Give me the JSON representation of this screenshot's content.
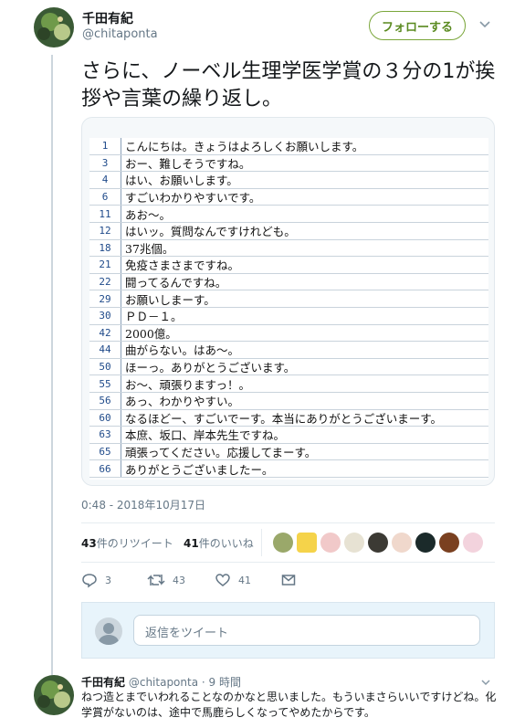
{
  "tweet": {
    "author_name": "千田有紀",
    "author_handle": "@chitaponta",
    "follow_label": "フォローする",
    "text": "さらに、ノーベル生理学医学賞の３分の1が挨拶や言葉の繰り返し。",
    "timestamp": "0:48 - 2018年10月17日"
  },
  "transcript_rows": [
    {
      "num": "1",
      "text": "こんにちは。きょうはよろしくお願いします。"
    },
    {
      "num": "3",
      "text": "おー、難しそうですね。"
    },
    {
      "num": "4",
      "text": "はい、お願いします。"
    },
    {
      "num": "6",
      "text": "すごいわかりやすいです。"
    },
    {
      "num": "11",
      "text": "あお～。"
    },
    {
      "num": "12",
      "text": "はいッ。質問なんですけれども。"
    },
    {
      "num": "18",
      "text": "37兆個。"
    },
    {
      "num": "21",
      "text": "免疫さまさまですね。"
    },
    {
      "num": "22",
      "text": "闘ってるんですね。"
    },
    {
      "num": "29",
      "text": "お願いしまーす。"
    },
    {
      "num": "30",
      "text": "ＰＤ－１。"
    },
    {
      "num": "42",
      "text": "2000億。"
    },
    {
      "num": "44",
      "text": "曲がらない。はあ～。"
    },
    {
      "num": "50",
      "text": "ほーっ。ありがとうございます。"
    },
    {
      "num": "55",
      "text": "お～、頑張りますっ！。"
    },
    {
      "num": "56",
      "text": "あっ、わかりやすい。"
    },
    {
      "num": "60",
      "text": "なるほどー、すごいでーす。本当にありがとうございまーす。"
    },
    {
      "num": "63",
      "text": "本庶、坂口、岸本先生ですね。"
    },
    {
      "num": "65",
      "text": "頑張ってください。応援してまーす。"
    },
    {
      "num": "66",
      "text": "ありがとうございましたー。"
    }
  ],
  "stats": {
    "retweets_count": "43",
    "retweets_label": "件のリツイート",
    "likes_count": "41",
    "likes_label": "件のいいね"
  },
  "actions": {
    "reply_count": "3",
    "retweet_count": "43",
    "like_count": "41"
  },
  "reply_box": {
    "placeholder": "返信をツイート"
  },
  "reply": {
    "author_name": "千田有紀",
    "author_handle": "@chitaponta",
    "time": "· 9 時間",
    "text": "ねつ造とまでいわれることなのかなと思いました。もういまさらいいですけどね。化学賞がないのは、途中で馬鹿らしくなってやめたからです。"
  },
  "colors": {
    "follow_green": "#7aa63a",
    "link_blue": "#1f4a8a",
    "muted": "#657786",
    "reply_bg": "#e8f4fb"
  }
}
